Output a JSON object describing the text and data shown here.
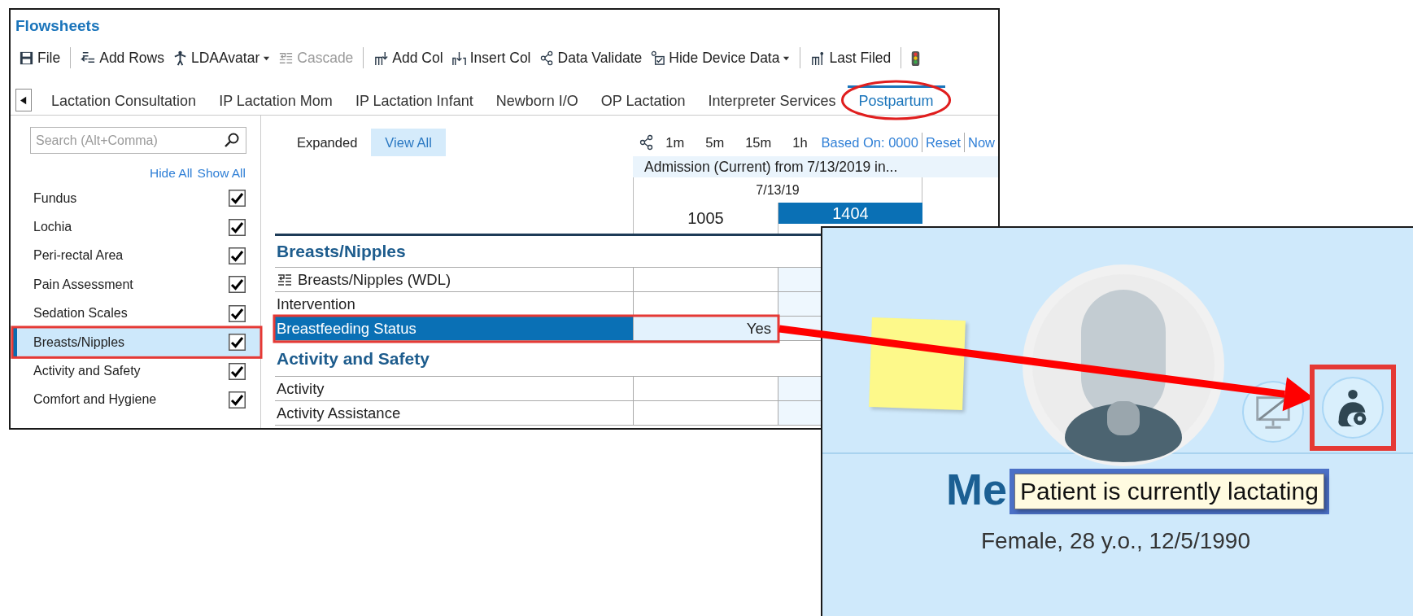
{
  "window": {
    "title": "Flowsheets"
  },
  "toolbar": [
    {
      "kind": "save",
      "label": "File",
      "disabled": false,
      "dropdown": false
    },
    {
      "kind": "separator"
    },
    {
      "kind": "add_rows",
      "label": "Add Rows",
      "disabled": false,
      "dropdown": false
    },
    {
      "kind": "avatar",
      "label": "LDAAvatar",
      "disabled": false,
      "dropdown": true
    },
    {
      "kind": "cascade",
      "label": "Cascade",
      "disabled": true,
      "dropdown": false
    },
    {
      "kind": "separator"
    },
    {
      "kind": "add_col",
      "label": "Add Col",
      "disabled": false,
      "dropdown": false
    },
    {
      "kind": "insert_col",
      "label": "Insert Col",
      "disabled": false,
      "dropdown": false
    },
    {
      "kind": "validate",
      "label": "Data Validate",
      "disabled": false,
      "dropdown": false
    },
    {
      "kind": "hide_device",
      "label": "Hide Device Data",
      "disabled": false,
      "dropdown": true
    },
    {
      "kind": "separator"
    },
    {
      "kind": "last_filed",
      "label": "Last Filed",
      "disabled": false,
      "dropdown": false
    },
    {
      "kind": "separator"
    },
    {
      "kind": "traffic"
    }
  ],
  "tabs": [
    {
      "label": "Lactation Consultation",
      "selected": false
    },
    {
      "label": "IP Lactation Mom",
      "selected": false
    },
    {
      "label": "IP Lactation Infant",
      "selected": false
    },
    {
      "label": "Newborn I/O",
      "selected": false
    },
    {
      "label": "OP Lactation",
      "selected": false
    },
    {
      "label": "Interpreter Services",
      "selected": false
    },
    {
      "label": "Postpartum",
      "selected": true
    }
  ],
  "sidebar": {
    "search": {
      "placeholder": "Search (Alt+Comma)"
    },
    "links": [
      "Hide All",
      "Show All"
    ],
    "items": [
      {
        "label": "Fundus",
        "checked": true,
        "selected": false
      },
      {
        "label": "Lochia",
        "checked": true,
        "selected": false
      },
      {
        "label": "Peri-rectal Area",
        "checked": true,
        "selected": false
      },
      {
        "label": "Pain Assessment",
        "checked": true,
        "selected": false
      },
      {
        "label": "Sedation Scales",
        "checked": true,
        "selected": false
      },
      {
        "label": "Breasts/Nipples",
        "checked": true,
        "selected": true
      },
      {
        "label": "Activity and Safety",
        "checked": true,
        "selected": false
      },
      {
        "label": "Comfort and Hygiene",
        "checked": true,
        "selected": false
      }
    ]
  },
  "flowsheet": {
    "view_buttons": [
      {
        "label": "Expanded",
        "selected": false
      },
      {
        "label": "View All",
        "selected": true
      }
    ],
    "intervals": [
      "1m",
      "5m",
      "15m",
      "1h"
    ],
    "links": [
      "Based On: 0000",
      "Reset",
      "Now"
    ],
    "encounter": "Admission (Current) from 7/13/2019 in...",
    "date": "7/13/19",
    "times": [
      {
        "label": "1005",
        "selected": false
      },
      {
        "label": "1404",
        "selected": true
      }
    ],
    "sections": [
      {
        "title": "Breasts/Nipples",
        "rows": [
          {
            "label": "Breasts/Nipples (WDL)",
            "kind": "cascade",
            "selected": false
          },
          {
            "label": "Intervention",
            "kind": "plain",
            "selected": false
          },
          {
            "label": "Breastfeeding Status",
            "kind": "plain",
            "selected": true,
            "value": "Yes"
          }
        ]
      },
      {
        "title": "Activity and Safety",
        "rows": [
          {
            "label": "Activity",
            "kind": "plain",
            "selected": false
          },
          {
            "label": "Activity Assistance",
            "kind": "plain",
            "selected": false
          }
        ]
      }
    ]
  },
  "patient_header": {
    "status_icons": [
      {
        "kind": "monitor_off"
      },
      {
        "kind": "lactating"
      }
    ],
    "name": "Me",
    "tooltip": "Patient is currently lactating",
    "demographics": "Female, 28 y.o., 12/5/1990"
  }
}
